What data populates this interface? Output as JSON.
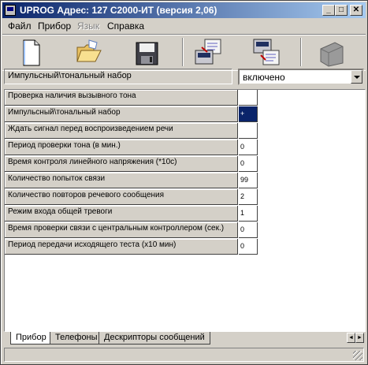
{
  "window": {
    "title": "UPROG  Адрес: 127  С2000-ИТ (версия  2,06)"
  },
  "title_buttons": {
    "minimize": "_",
    "maximize": "□",
    "close": "✕"
  },
  "menu": [
    {
      "label": "Файл",
      "enabled": true
    },
    {
      "label": "Прибор",
      "enabled": true
    },
    {
      "label": "Язык",
      "enabled": false
    },
    {
      "label": "Справка",
      "enabled": true
    }
  ],
  "toolbar": {
    "tools": [
      {
        "name": "new-file-icon",
        "enabled": true
      },
      {
        "name": "open-folder-icon",
        "enabled": true
      },
      {
        "name": "save-icon",
        "enabled": true
      },
      {
        "name": "read-from-device-icon",
        "enabled": true
      },
      {
        "name": "write-to-device-icon",
        "enabled": true
      },
      {
        "name": "device-icon",
        "enabled": false
      }
    ]
  },
  "param_bar": {
    "label": "Импульсный\\тональный набор",
    "value": "включено"
  },
  "grid": {
    "rows": [
      {
        "label": "Проверка наличия вызывного тона",
        "value": ""
      },
      {
        "label": "Импульсный\\тональный набор",
        "value": "+",
        "selected": true
      },
      {
        "label": "Ждать сигнал перед воспроизведением речи",
        "value": ""
      },
      {
        "label": "Период проверки тона (в мин.)",
        "value": "0"
      },
      {
        "label": "Время контроля линейного напряжения (*10с)",
        "value": "0"
      },
      {
        "label": "Количество попыток связи",
        "value": "99"
      },
      {
        "label": "Количество повторов речевого сообщения",
        "value": "2"
      },
      {
        "label": "Режим входа общей тревоги",
        "value": "1"
      },
      {
        "label": "Время проверки связи с центральным контроллером (сек.)",
        "value": "0"
      },
      {
        "label": "Период передачи исходящего теста (x10 мин)",
        "value": "0"
      }
    ]
  },
  "tabs": [
    {
      "label": "Прибор",
      "active": true
    },
    {
      "label": "Телефоны",
      "active": false
    },
    {
      "label": "Дескрипторы сообщений",
      "active": false
    }
  ]
}
